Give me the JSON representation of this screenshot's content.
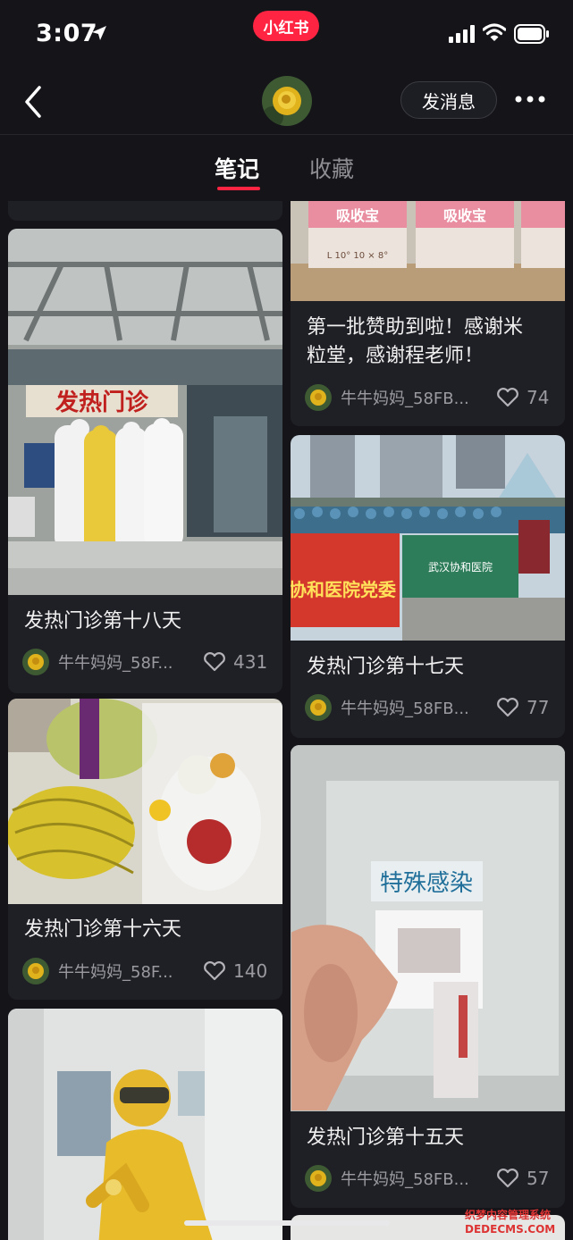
{
  "status": {
    "time": "3:07"
  },
  "app": {
    "badge": "小红书"
  },
  "header": {
    "message_button": "发消息"
  },
  "tabs": [
    {
      "label": "笔记",
      "active": true
    },
    {
      "label": "收藏",
      "active": false
    }
  ],
  "colors": {
    "background": "#141419",
    "card": "#1f1f26",
    "accent": "#ff2442",
    "muted": "#9a9aa0"
  },
  "notes": [
    {
      "title": "发热门诊第十八天",
      "author": "牛牛妈妈_58F...",
      "likes": "431"
    },
    {
      "title": "第一批赞助到啦！感谢米粒堂，感谢程老师！",
      "title_line1": "第一批赞助到啦！感谢米",
      "title_line2": "粒堂，感谢程老师！",
      "author": "牛牛妈妈_58FB...",
      "likes": "74"
    },
    {
      "title": "发热门诊第十七天",
      "author": "牛牛妈妈_58FB...",
      "likes": "77"
    },
    {
      "title": "发热门诊第十六天",
      "author": "牛牛妈妈_58F...",
      "likes": "140"
    },
    {
      "title": "发热门诊第十五天",
      "author": "牛牛妈妈_58FB...",
      "likes": "57"
    }
  ],
  "photo_text": {
    "fever_clinic_sign": "发热门诊",
    "box_brand": "吸收宝",
    "box_size_1": "L 10° 10 × 8°",
    "banner_1": "协和医院党委",
    "banner_2": "武汉协和医院",
    "bag_label": "特殊感染"
  },
  "watermark": {
    "line1": "织梦内容管理系统",
    "line2": "DEDECMS.COM"
  }
}
